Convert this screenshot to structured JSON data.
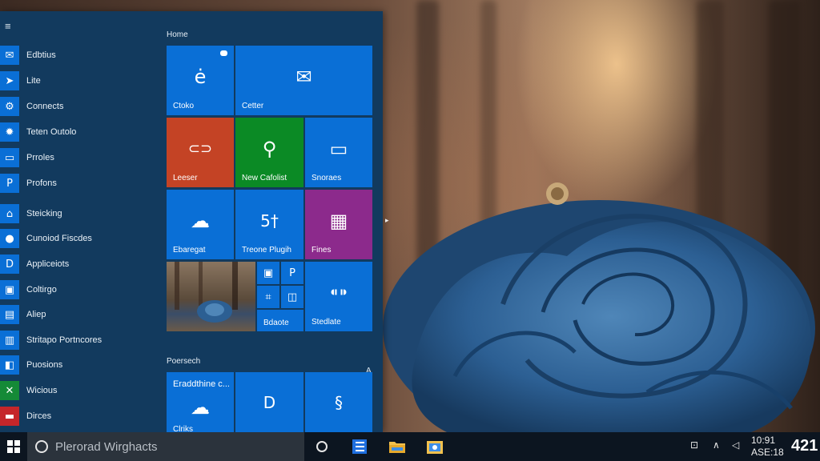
{
  "start_menu": {
    "apps": [
      {
        "label": "Edbtius",
        "icon": "mail-icon",
        "glyph": "✉"
      },
      {
        "label": "Lite",
        "icon": "pin-icon",
        "glyph": "➤"
      },
      {
        "label": "Connects",
        "icon": "gear-outline-icon",
        "glyph": "⚙"
      },
      {
        "label": "Teten Outolo",
        "icon": "gear-icon",
        "glyph": "✹"
      },
      {
        "label": "Prroles",
        "icon": "window-icon",
        "glyph": "▭"
      },
      {
        "label": "Profons",
        "icon": "p-letter-icon",
        "glyph": "P"
      },
      {
        "label": "Steicking",
        "icon": "house-icon",
        "glyph": "⌂"
      },
      {
        "label": "Cunoiod Fiscdes",
        "icon": "chat-bubble-icon",
        "glyph": "●"
      },
      {
        "label": "Appliceiots",
        "icon": "d-letter-icon",
        "glyph": "D"
      },
      {
        "label": "Coltirgo",
        "icon": "display-icon",
        "glyph": "▣"
      },
      {
        "label": "Aliep",
        "icon": "document-icon",
        "glyph": "▤"
      },
      {
        "label": "Stritapo Portncores",
        "icon": "store-icon",
        "glyph": "▥"
      },
      {
        "label": "Puosions",
        "icon": "people-icon",
        "glyph": "◧"
      },
      {
        "label": "Wicious",
        "icon": "xbox-icon",
        "glyph": "✕"
      },
      {
        "label": "Dirces",
        "icon": "briefcase-icon",
        "glyph": "▬"
      }
    ],
    "groups": [
      {
        "label": "Home"
      },
      {
        "label": "Poersech",
        "collapse": "A"
      }
    ],
    "tiles": {
      "edge": {
        "label": "Ctoko",
        "glyph": "ė",
        "color": "#0a6fd6"
      },
      "mail": {
        "label": "Cetter",
        "glyph": "✉",
        "color": "#0a6fd6"
      },
      "groove": {
        "label": "Leeser",
        "glyph": "⊂⊃",
        "color": "#c44325"
      },
      "new-calc": {
        "label": "New Cafolist",
        "glyph": "⚲",
        "color": "#0b8a25"
      },
      "snoraes": {
        "label": "Snoraes",
        "glyph": "▭",
        "color": "#0a6fd6"
      },
      "weather": {
        "label": "Ebaregat",
        "glyph": "☁",
        "color": "#0a6fd6"
      },
      "trecne": {
        "label": "Treone Plugih",
        "glyph": "5†",
        "color": "#0a6fd6"
      },
      "fines": {
        "label": "Fines",
        "glyph": "▦",
        "color": "#8c2a8c"
      },
      "photo": {
        "label": "",
        "color": "#6b5a48"
      },
      "bdaote": {
        "label": "Bdaote",
        "color": "#0a6fd6"
      },
      "stedlate": {
        "label": "Stedlate",
        "glyph": "⁌⁍",
        "color": "#0a6fd6"
      },
      "eraddthine": {
        "label": "Eraddthine c...",
        "sub": "Clriks",
        "glyph": "☁",
        "color": "#0a6fd6"
      },
      "d-app": {
        "label": "",
        "glyph": "D",
        "color": "#0a6fd6"
      },
      "s-app": {
        "label": "",
        "glyph": "§",
        "color": "#0a6fd6"
      }
    },
    "mini_tiles": [
      {
        "glyph": "▣",
        "icon": "image-icon"
      },
      {
        "glyph": "P",
        "icon": "p-letter-icon"
      },
      {
        "glyph": "⌗",
        "icon": "grid-icon"
      },
      {
        "glyph": "◫",
        "icon": "panel-icon"
      }
    ]
  },
  "taskbar": {
    "search_placeholder": "Plerorad Wirghacts",
    "tray": {
      "battery": "⊡",
      "network": "∧",
      "volume": "◁"
    },
    "clock": {
      "line1": "10:91",
      "line2": "ASE:18"
    },
    "big_number": "421"
  },
  "colors": {
    "accent": "#0a6fd6",
    "menu_bg": "#123a5e",
    "taskbar_bg": "#0c1520"
  }
}
